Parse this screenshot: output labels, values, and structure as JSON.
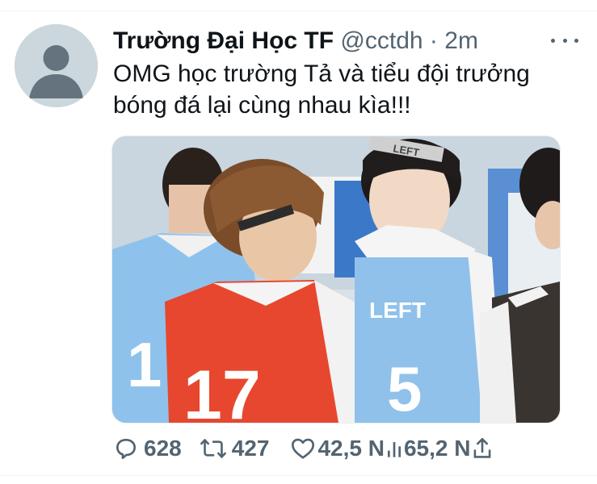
{
  "tweet": {
    "display_name": "Trường Đại Học TF",
    "handle": "@cctdh",
    "separator": "·",
    "time": "2m",
    "text_line1": "OMG học trường Tả và tiểu đội trưởng",
    "text_line2": "bóng đá lại cùng nhau kìa!!!",
    "media_description": "Two young basketball players in red and blue team jerseys standing close together",
    "jersey_number_red": "17",
    "jersey_text_blue": "LEFT",
    "headband_text": "LEFT"
  },
  "actions": {
    "replies": "628",
    "retweets": "427",
    "likes": "42,5 N",
    "views": "65,2 N"
  },
  "icons": {
    "avatar": "default-avatar-icon",
    "more": "more-dots-icon",
    "reply": "reply-icon",
    "retweet": "retweet-icon",
    "like": "heart-icon",
    "views": "analytics-icon",
    "share": "share-icon"
  },
  "colors": {
    "text": "#0f1419",
    "secondary": "#536471",
    "avatar_bg": "#ccd6dd",
    "red_jersey": "#e8472f",
    "blue_jersey": "#8ec2ec"
  }
}
